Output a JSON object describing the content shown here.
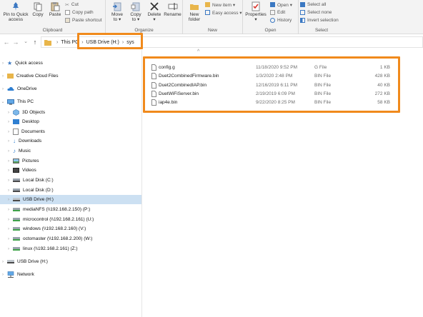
{
  "ribbon": {
    "clipboard": {
      "label": "Clipboard",
      "pin_label_1": "Pin to Quick",
      "pin_label_2": "access",
      "copy_label": "Copy",
      "paste_label": "Paste",
      "cut_label": "Cut",
      "copy_path_label": "Copy path",
      "paste_shortcut_label": "Paste shortcut"
    },
    "organize": {
      "label": "Organize",
      "move_to_1": "Move",
      "move_to_2": "to ▾",
      "copy_to_1": "Copy",
      "copy_to_2": "to ▾",
      "delete_1": "Delete",
      "delete_2": "▾",
      "rename_label": "Rename"
    },
    "new": {
      "label": "New",
      "new_folder_1": "New",
      "new_folder_2": "folder",
      "new_item_label": "New item ▾",
      "easy_access_label": "Easy access ▾"
    },
    "open": {
      "label": "Open",
      "properties_1": "Properties",
      "properties_2": "▾",
      "open_label": "Open ▾",
      "edit_label": "Edit",
      "history_label": "History"
    },
    "select": {
      "label": "Select",
      "select_all_label": "Select all",
      "select_none_label": "Select none",
      "invert_selection_label": "Invert selection"
    }
  },
  "address": {
    "back": "←",
    "forward": "→",
    "recent": "⌄",
    "up": "↑",
    "crumbs": [
      "This PC",
      "USB Drive (H:)",
      "sys"
    ],
    "separator": "›"
  },
  "sort_indicator": "^",
  "nav": {
    "items": [
      {
        "label": "Quick access",
        "icon": "star-icon"
      },
      {
        "label": "Creative Cloud Files",
        "icon": "creative-cloud-icon"
      },
      {
        "label": "OneDrive",
        "icon": "onedrive-icon"
      },
      {
        "label": "This PC",
        "icon": "computer-icon"
      },
      {
        "label": "3D Objects",
        "icon": "3d-objects-icon"
      },
      {
        "label": "Desktop",
        "icon": "desktop-icon"
      },
      {
        "label": "Documents",
        "icon": "documents-icon"
      },
      {
        "label": "Downloads",
        "icon": "downloads-icon"
      },
      {
        "label": "Music",
        "icon": "music-icon"
      },
      {
        "label": "Pictures",
        "icon": "pictures-icon"
      },
      {
        "label": "Videos",
        "icon": "videos-icon"
      },
      {
        "label": "Local Disk (C:)",
        "icon": "drive-icon"
      },
      {
        "label": "Local Disk (D:)",
        "icon": "drive-icon"
      },
      {
        "label": "USB Drive (H:)",
        "icon": "usb-drive-icon"
      },
      {
        "label": "mediaNFS (\\\\192.168.2.150) (P:)",
        "icon": "network-drive-icon"
      },
      {
        "label": "microcontrol (\\\\192.168.2.161) (U:)",
        "icon": "network-drive-icon"
      },
      {
        "label": "windows (\\\\192.168.2.160) (V:)",
        "icon": "network-drive-icon"
      },
      {
        "label": "octomaster (\\\\192.168.2.200) (W:)",
        "icon": "network-drive-icon"
      },
      {
        "label": "linux (\\\\192.168.2.161) (Z:)",
        "icon": "network-drive-icon"
      },
      {
        "label": "USB Drive (H:)",
        "icon": "usb-drive-icon"
      },
      {
        "label": "Network",
        "icon": "network-icon"
      }
    ],
    "expand_glyph": "›",
    "collapse_glyph": "⌄"
  },
  "files": [
    {
      "name": "config.g",
      "date": "11/18/2020 9:52 PM",
      "type": "G File",
      "size": "1 KB"
    },
    {
      "name": "Duet2CombinedFirmware.bin",
      "date": "1/3/2020 2:48 PM",
      "type": "BIN File",
      "size": "428 KB"
    },
    {
      "name": "Duet2CombinedIAP.bin",
      "date": "12/16/2019 6:11 PM",
      "type": "BIN File",
      "size": "40 KB"
    },
    {
      "name": "DuetWiFiServer.bin",
      "date": "2/19/2019 6:09 PM",
      "type": "BIN File",
      "size": "272 KB"
    },
    {
      "name": "iap4e.bin",
      "date": "9/22/2020 8:25 PM",
      "type": "BIN File",
      "size": "58 KB"
    }
  ],
  "colors": {
    "highlight": "#f08a1c",
    "selection": "#cce0f2",
    "folder": "#e8b54a"
  }
}
